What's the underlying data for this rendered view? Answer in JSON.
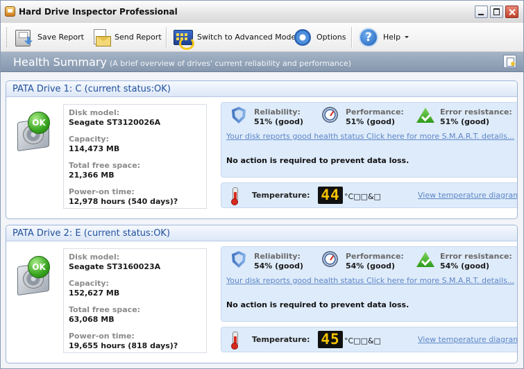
{
  "window": {
    "title": "Hard Drive Inspector Professional"
  },
  "toolbar": {
    "save_report": "Save Report",
    "send_report": "Send Report",
    "switch_mode": "Switch to Advanced Mode",
    "options": "Options",
    "help": "Help"
  },
  "summary": {
    "title": "Health Summary",
    "subtitle": "(A brief overview of drives' current reliability and performance)"
  },
  "drives": [
    {
      "title": "PATA Drive 1: C (current status:OK)",
      "badge": "OK",
      "disk_model_label": "Disk model:",
      "disk_model": "Seagate ST3120026A",
      "capacity_label": "Capacity:",
      "capacity": "114,473 MB",
      "free_label": "Total free space:",
      "free": "21,366 MB",
      "power_label": "Power-on time:",
      "power": "12,978 hours (540 days)?",
      "reliability_label": "Reliability:",
      "reliability": "51% (good)",
      "performance_label": "Performance:",
      "performance": "51% (good)",
      "error_label": "Error resistance:",
      "error": "51% (good)",
      "smart_link": "Your disk reports good health status Click here for more S.M.A.R.T. details...",
      "action": "No action is required to prevent data loss.",
      "temp_label": "Temperature:",
      "temp": "44",
      "temp_unit": "°C□□&□",
      "temp_link": "View temperature diagram"
    },
    {
      "title": "PATA Drive 2: E (current status:OK)",
      "badge": "OK",
      "disk_model_label": "Disk model:",
      "disk_model": "Seagate ST3160023A",
      "capacity_label": "Capacity:",
      "capacity": "152,627 MB",
      "free_label": "Total free space:",
      "free": "63,068 MB",
      "power_label": "Power-on time:",
      "power": "19,655 hours (818 days)?",
      "reliability_label": "Reliability:",
      "reliability": "54% (good)",
      "performance_label": "Performance:",
      "performance": "54% (good)",
      "error_label": "Error resistance:",
      "error": "54% (good)",
      "smart_link": "Your disk reports good health status Click here for more S.M.A.R.T. details...",
      "action": "No action is required to prevent data loss.",
      "temp_label": "Temperature:",
      "temp": "45",
      "temp_unit": "°C□□&□",
      "temp_link": "View temperature diagram"
    }
  ],
  "colors": {
    "header_blue": "#1f4f9c",
    "link_blue": "#5d86c7",
    "status_bg": "#deebfa",
    "lcd_digits": "#f5c300",
    "ok_green": "#37a41e"
  },
  "icons": {
    "save": "save-disk-icon",
    "send": "send-mail-icon",
    "switch": "advanced-mode-icon",
    "options": "gear-icon",
    "help": "help-icon",
    "reliability": "shield-icon",
    "performance": "gauge-icon",
    "error": "checkmark-triangle-icon",
    "temperature": "thermometer-icon"
  }
}
